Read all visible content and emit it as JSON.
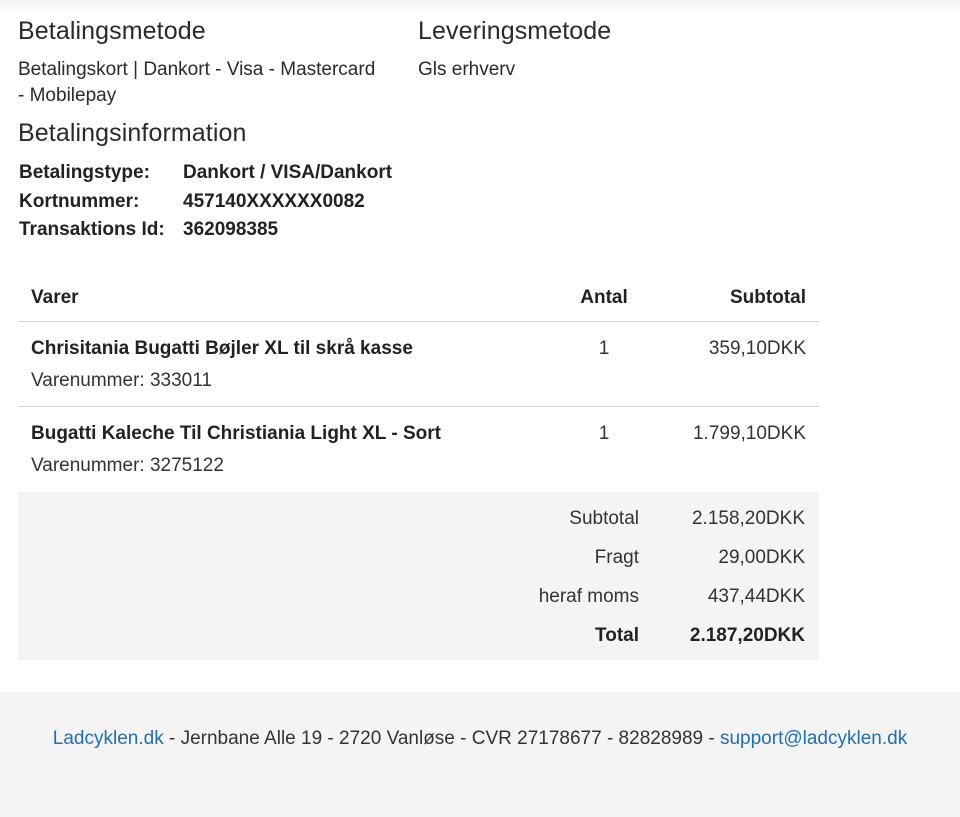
{
  "payment_method": {
    "title": "Betalingsmetode",
    "value_line1": "Betalingskort | Dankort - Visa - Mastercard",
    "value_line2": "- Mobilepay"
  },
  "delivery_method": {
    "title": "Leveringsmetode",
    "value": "Gls erhverv"
  },
  "payment_info": {
    "title": "Betalingsinformation",
    "rows": [
      {
        "label": "Betalingstype:",
        "value": "Dankort / VISA/Dankort"
      },
      {
        "label": "Kortnummer:",
        "value": "457140XXXXXX0082"
      },
      {
        "label": "Transaktions Id:",
        "value": "362098385"
      }
    ]
  },
  "items": {
    "headers": {
      "name": "Varer",
      "qty": "Antal",
      "subtotal": "Subtotal"
    },
    "rows": [
      {
        "name": "Chrisitania Bugatti Bøjler XL til skrå kasse",
        "sku": "Varenummer: 333011",
        "qty": "1",
        "subtotal": "359,10DKK"
      },
      {
        "name": "Bugatti Kaleche Til Christiania Light XL - Sort",
        "sku": "Varenummer: 3275122",
        "qty": "1",
        "subtotal": "1.799,10DKK"
      }
    ]
  },
  "totals": [
    {
      "label": "Subtotal",
      "value": "2.158,20DKK"
    },
    {
      "label": "Fragt",
      "value": "29,00DKK"
    },
    {
      "label": "heraf moms",
      "value": "437,44DKK"
    },
    {
      "label": "Total",
      "value": "2.187,20DKK"
    }
  ],
  "footer": {
    "site_link": "Ladcyklen.dk",
    "address": " - Jernbane Alle 19 - 2720 Vanløse - CVR 27178677 - 82828989 - ",
    "email_link": "support@ladcyklen.dk",
    "link_color": "#1d6fb8"
  }
}
